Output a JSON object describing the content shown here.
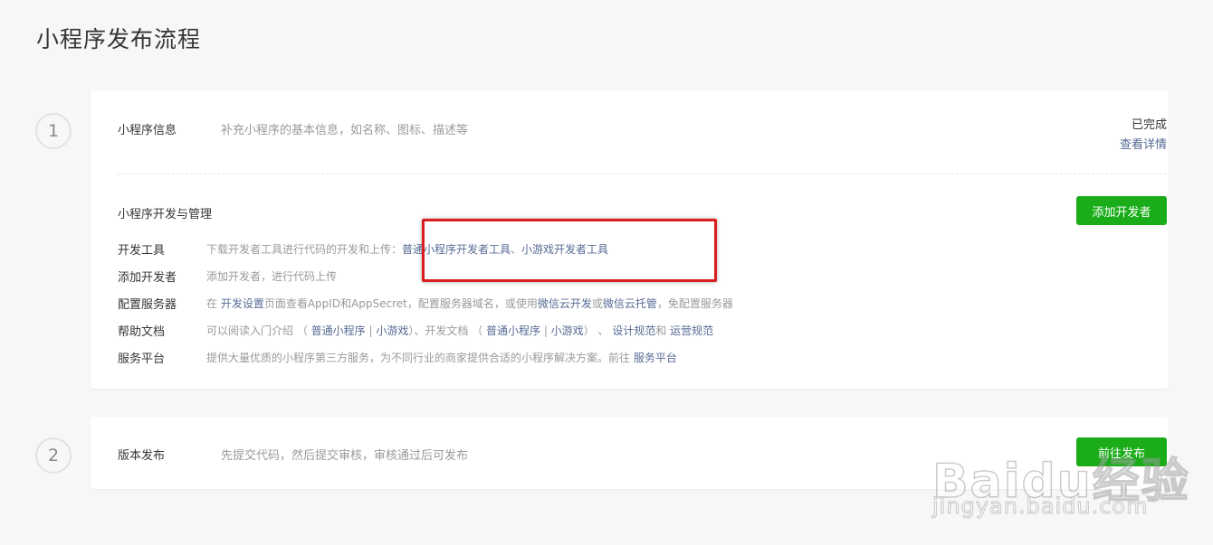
{
  "page": {
    "title": "小程序发布流程"
  },
  "steps": [
    {
      "number": "1"
    },
    {
      "number": "2"
    }
  ],
  "step1": {
    "info": {
      "title": "小程序信息",
      "desc": "补充小程序的基本信息，如名称、图标、描述等",
      "status": "已完成",
      "detail_link": "查看详情"
    },
    "dev": {
      "title": "小程序开发与管理",
      "add_dev_button": "添加开发者",
      "items": [
        {
          "label": "开发工具",
          "text": "下载开发者工具进行代码的开发和上传：",
          "link1": "普通小程序开发者工具",
          "sep": "、",
          "link2": "小游戏开发者工具"
        },
        {
          "label": "添加开发者",
          "text": "添加开发者，进行代码上传"
        },
        {
          "label": "配置服务器",
          "text_pre": "在 ",
          "link1": "开发设置",
          "text_mid1": "页面查看AppID和AppSecret，配置服务器域名，或使用",
          "link2": "微信云开发",
          "text_mid2": "或",
          "link3": "微信云托管",
          "text_post": "，免配置服务器"
        },
        {
          "label": "帮助文档",
          "text_pre": "可以阅读入门介绍 （ ",
          "link1": "普通小程序",
          "sep1": " | ",
          "link2": "小游戏",
          "text_mid": "）、开发文档 （ ",
          "link3": "普通小程序",
          "sep2": " | ",
          "link4": "小游戏",
          "text_mid2": "） 、 ",
          "link5": "设计规范",
          "text_and": "和 ",
          "link6": "运营规范"
        },
        {
          "label": "服务平台",
          "text": "提供大量优质的小程序第三方服务，为不同行业的商家提供合适的小程序解决方案。前往 ",
          "link": "服务平台"
        }
      ]
    }
  },
  "step2": {
    "title": "版本发布",
    "desc": "先提交代码，然后提交审核，审核通过后可发布",
    "button": "前往发布"
  },
  "watermark": {
    "logo": "Baidu经验",
    "url": "jingyan.baidu.com"
  },
  "colors": {
    "accent_green": "#1aad19",
    "link_blue": "#576b95",
    "highlight_red": "#d81e1e"
  }
}
